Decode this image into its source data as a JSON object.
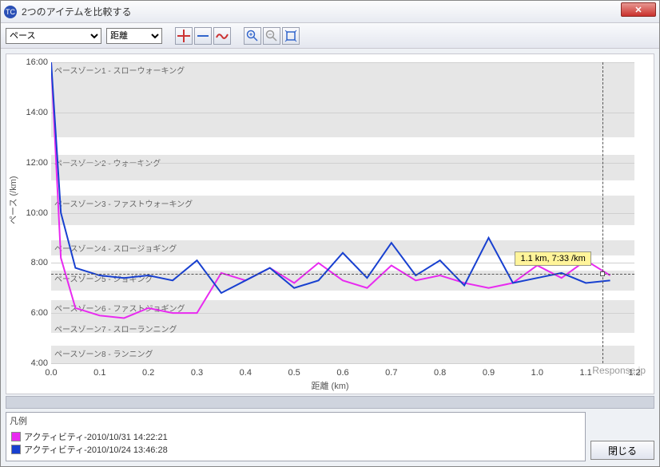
{
  "window": {
    "title": "2つのアイテムを比較する",
    "close_label": "✕"
  },
  "toolbar": {
    "select1": {
      "value": "ペース"
    },
    "select2": {
      "value": "距離"
    }
  },
  "axes": {
    "ylabel": "ペース (/km)",
    "xlabel": "距離 (km)",
    "yticks": [
      "16:00",
      "14:00",
      "12:00",
      "10:00",
      "8:00",
      "6:00",
      "4:00"
    ],
    "xticks": [
      "0.0",
      "0.1",
      "0.2",
      "0.3",
      "0.4",
      "0.5",
      "0.6",
      "0.7",
      "0.8",
      "0.9",
      "1.0",
      "1.1",
      "1.2"
    ]
  },
  "zones": [
    {
      "label": "ペースゾーン1 - スローウォーキング"
    },
    {
      "label": "ペースゾーン2 - ウォーキング"
    },
    {
      "label": "ペースゾーン3 - ファストウォーキング"
    },
    {
      "label": "ペースゾーン4 - スロージョギング"
    },
    {
      "label": "ペースゾーン5 - ジョギング"
    },
    {
      "label": "ペースゾーン6 - ファストジョギング"
    },
    {
      "label": "ペースゾーン7 - スローランニング"
    },
    {
      "label": "ペースゾーン8 - ランニング"
    }
  ],
  "tooltip": {
    "text": "1.1 km, 7:33 /km"
  },
  "watermark": "Response.jp",
  "legend": {
    "title": "凡例",
    "items": [
      {
        "color": "#e82af0",
        "label": "アクティビティ-2010/10/31 14:22:21"
      },
      {
        "color": "#1840d0",
        "label": "アクティビティ-2010/10/24 13:46:28"
      }
    ]
  },
  "buttons": {
    "close_bottom": "閉じる"
  },
  "chart_data": {
    "type": "line",
    "xlabel": "距離 (km)",
    "ylabel": "ペース (/km)",
    "xlim": [
      0.0,
      1.2
    ],
    "ylim_minutes": [
      4.0,
      16.0
    ],
    "x": [
      0.0,
      0.02,
      0.05,
      0.1,
      0.15,
      0.2,
      0.25,
      0.3,
      0.35,
      0.4,
      0.45,
      0.5,
      0.55,
      0.6,
      0.65,
      0.7,
      0.75,
      0.8,
      0.85,
      0.9,
      0.95,
      1.0,
      1.05,
      1.1,
      1.15
    ],
    "series": [
      {
        "name": "アクティビティ-2010/10/31 14:22:21",
        "color": "#e82af0",
        "pace_min_per_km": [
          16.0,
          8.2,
          6.2,
          5.9,
          5.8,
          6.2,
          6.0,
          6.0,
          7.6,
          7.3,
          7.8,
          7.2,
          8.0,
          7.3,
          7.0,
          7.9,
          7.3,
          7.5,
          7.2,
          7.0,
          7.2,
          7.9,
          7.4,
          8.1,
          7.5
        ]
      },
      {
        "name": "アクティビティ-2010/10/24 13:46:28",
        "color": "#1840d0",
        "pace_min_per_km": [
          16.0,
          10.0,
          7.8,
          7.5,
          7.4,
          7.5,
          7.3,
          8.1,
          6.8,
          7.3,
          7.8,
          7.0,
          7.3,
          8.4,
          7.4,
          8.8,
          7.5,
          8.1,
          7.1,
          9.0,
          7.2,
          7.4,
          7.6,
          7.2,
          7.3
        ]
      }
    ],
    "pace_zones_minutes": [
      {
        "name": "ペースゾーン1 - スローウォーキング",
        "from": 13.0,
        "to": 16.0
      },
      {
        "name": "ペースゾーン2 - ウォーキング",
        "from": 11.3,
        "to": 12.3
      },
      {
        "name": "ペースゾーン3 - ファストウォーキング",
        "from": 9.5,
        "to": 10.7
      },
      {
        "name": "ペースゾーン4 - スロージョギング",
        "from": 8.3,
        "to": 8.9
      },
      {
        "name": "ペースゾーン5 - ジョギング",
        "from": 6.9,
        "to": 7.7
      },
      {
        "name": "ペースゾーン6 - ファストジョギング",
        "from": 5.7,
        "to": 6.5
      },
      {
        "name": "ペースゾーン7 - スローランニング",
        "from": 5.2,
        "to": 5.7
      },
      {
        "name": "ペースゾーン8 - ランニング",
        "from": 4.0,
        "to": 4.7
      }
    ],
    "cursor": {
      "x_km": 1.135,
      "pace_min": 7.55,
      "label": "1.1 km, 7:33 /km"
    }
  }
}
